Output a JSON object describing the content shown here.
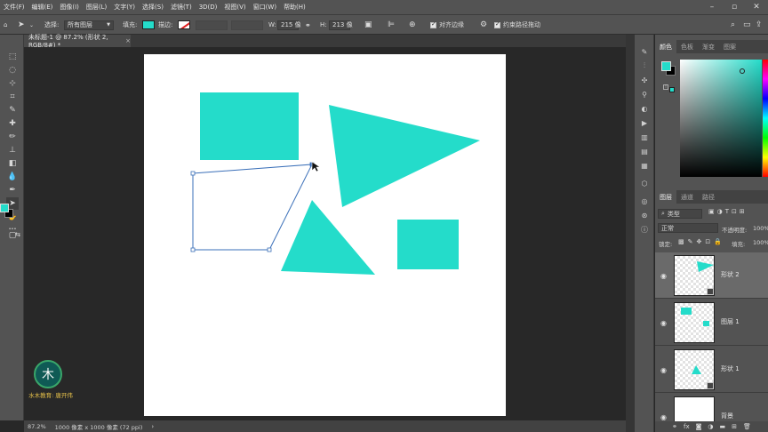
{
  "menu": {
    "items": [
      "文件(F)",
      "编辑(E)",
      "图像(I)",
      "图层(L)",
      "文字(Y)",
      "选择(S)",
      "滤镜(T)",
      "3D(D)",
      "视图(V)",
      "窗口(W)",
      "帮助(H)"
    ]
  },
  "options": {
    "select_label": "选择:",
    "select_value": "所有图层",
    "fill_label": "填充:",
    "stroke_label": "描边:",
    "w_label": "W:",
    "w_value": "215 像",
    "h_label": "H:",
    "h_value": "213 像",
    "align_edges_label": "对齐边缘",
    "constrain_path_label": "约束路径拖动"
  },
  "document": {
    "tab_title": "未标题-1 @ 87.2% (形状 2, RGB/8#) *",
    "close_glyph": "×"
  },
  "status": {
    "zoom": "87.2%",
    "doc_info": "1000 像素 x 1000 像素 (72 ppi)"
  },
  "watermark": {
    "text": "水木教育: 唐开伟"
  },
  "color_panel": {
    "tabs": [
      "颜色",
      "色板",
      "渐变",
      "图案"
    ],
    "foreground": "#24dcca",
    "background": "#000000"
  },
  "layers_panel": {
    "tabs": [
      "图层",
      "通道",
      "路径"
    ],
    "filter_label": "类型",
    "blend_mode": "正常",
    "opacity_label": "不透明度:",
    "opacity_value": "100%",
    "lock_label": "锁定:",
    "fill_label": "填充:",
    "fill_value": "100%",
    "layers": [
      {
        "name": "形状 2",
        "selected": true
      },
      {
        "name": "图层 1",
        "selected": false
      },
      {
        "name": "形状 1",
        "selected": false
      },
      {
        "name": "背景",
        "selected": false
      }
    ]
  },
  "colors": {
    "shape": "#24dcca",
    "ui": "#535353",
    "workspace": "#282828",
    "path": "#3a6fb8"
  }
}
